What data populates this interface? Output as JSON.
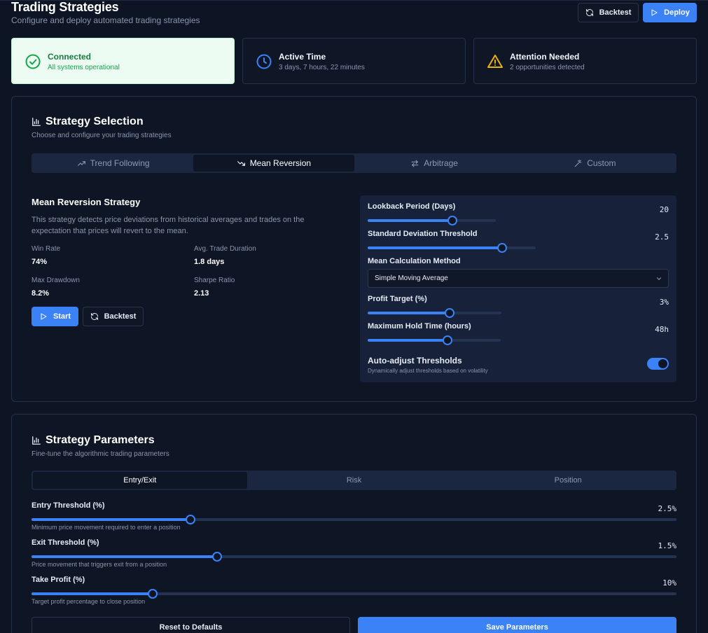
{
  "header": {
    "title": "Trading Strategies",
    "subtitle": "Configure and deploy automated trading strategies",
    "backtest_label": "Backtest",
    "deploy_label": "Deploy"
  },
  "status_cards": [
    {
      "title": "Connected",
      "detail": "All systems operational",
      "icon": "check-circle-icon",
      "color": "#16a34a"
    },
    {
      "title": "Active Time",
      "detail": "3 days, 7 hours, 22 minutes",
      "icon": "clock-icon",
      "color": "#3b82f6"
    },
    {
      "title": "Attention Needed",
      "detail": "2 opportunities detected",
      "icon": "warning-icon",
      "color": "#eab308"
    }
  ],
  "strategy_selection": {
    "title": "Strategy Selection",
    "subtitle": "Choose and configure your trading strategies",
    "tabs": [
      {
        "label": "Trend Following",
        "icon": "trending-up-icon"
      },
      {
        "label": "Mean Reversion",
        "icon": "trending-down-icon",
        "active": true
      },
      {
        "label": "Arbitrage",
        "icon": "swap-arrows-icon"
      },
      {
        "label": "Custom",
        "icon": "magic-wand-icon"
      }
    ],
    "strategy": {
      "name": "Mean Reversion Strategy",
      "description": "This strategy detects price deviations from historical averages and trades on the expectation that prices will revert to the mean.",
      "stats": [
        {
          "label": "Win Rate",
          "value": "74%"
        },
        {
          "label": "Avg. Trade Duration",
          "value": "1.8 days"
        },
        {
          "label": "Max Drawdown",
          "value": "8.2%"
        },
        {
          "label": "Sharpe Ratio",
          "value": "2.13"
        }
      ],
      "start_label": "Start",
      "backtest_label": "Backtest"
    },
    "parameters": {
      "lookback": {
        "label": "Lookback Period (Days)",
        "value": "20",
        "level": 0.66
      },
      "std_dev": {
        "label": "Standard Deviation Threshold",
        "value": "2.5",
        "level": 0.8
      },
      "mean_method": {
        "label": "Mean Calculation Method",
        "value": "Simple Moving Average"
      },
      "profit_target": {
        "label": "Profit Target (%)",
        "value": "3%",
        "level": 0.61
      },
      "max_hold": {
        "label": "Maximum Hold Time (hours)",
        "value": "48h",
        "level": 0.6
      },
      "auto_adjust": {
        "label": "Auto-adjust Thresholds",
        "help": "Dynamically adjust thresholds based on volatility",
        "enabled": true
      }
    }
  },
  "strategy_parameters": {
    "title": "Strategy Parameters",
    "subtitle": "Fine-tune the algorithmic trading parameters",
    "tabs": [
      {
        "label": "Entry/Exit",
        "active": true
      },
      {
        "label": "Risk"
      },
      {
        "label": "Position"
      }
    ],
    "sliders": [
      {
        "label": "Entry Threshold (%)",
        "value": "2.5%",
        "help": "Minimum price movement required to enter a position",
        "level": 0.246
      },
      {
        "label": "Exit Threshold (%)",
        "value": "1.5%",
        "help": "Price movement that triggers exit from a position",
        "level": 0.288
      },
      {
        "label": "Take Profit (%)",
        "value": "10%",
        "help": "Target profit percentage to close position",
        "level": 0.188
      }
    ],
    "reset_label": "Reset to Defaults",
    "save_label": "Save Parameters"
  }
}
